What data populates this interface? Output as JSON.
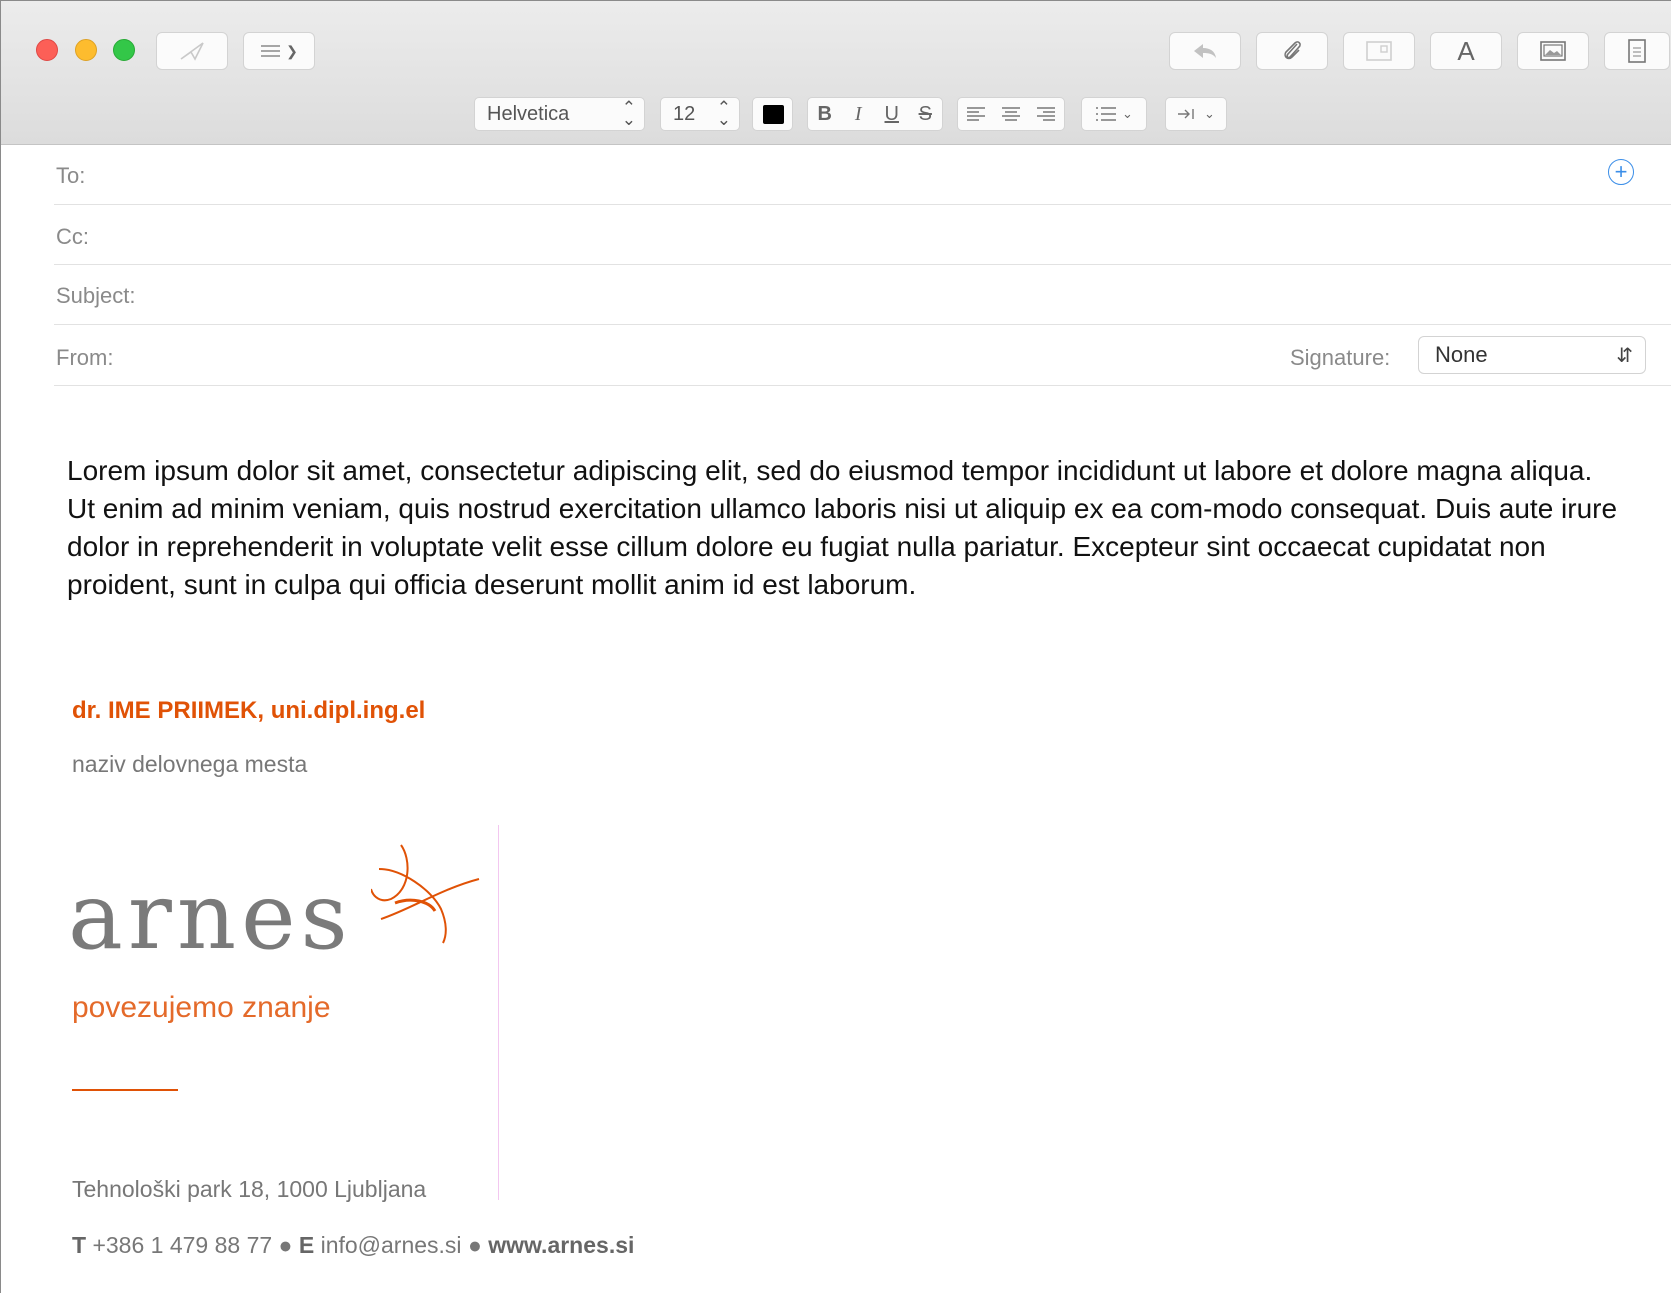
{
  "toolbar": {
    "icons": [
      "send-icon",
      "header-fields-icon",
      "reply-icon",
      "attachment-icon",
      "browser-icon",
      "fonts-icon",
      "photo-browser-icon",
      "stationery-icon"
    ],
    "header_fields_chevron": "⌄"
  },
  "format": {
    "font_family": "Helvetica",
    "font_size": "12",
    "text_color": "#000000",
    "bold": "B",
    "italic": "I",
    "underline": "U",
    "strikethrough": "S"
  },
  "fields": {
    "to_label": "To:",
    "cc_label": "Cc:",
    "subject_label": "Subject:",
    "from_label": "From:",
    "signature_label": "Signature:",
    "signature_value": "None"
  },
  "message": {
    "body": "Lorem ipsum dolor sit amet, consectetur adipiscing elit, sed do eiusmod tempor incididunt ut labore et dolore magna aliqua. Ut enim ad minim veniam, quis nostrud exercitation ullamco laboris nisi ut aliquip ex ea com-modo consequat. Duis aute irure dolor in reprehenderit in voluptate velit esse cillum dolore eu fugiat nulla pariatur. Excepteur sint occaecat cupidatat non proident, sunt in culpa qui officia deserunt mollit anim id est laborum."
  },
  "signature": {
    "name": "dr. IME PRIIMEK, uni.dipl.ing.el",
    "role": "naziv delovnega mesta",
    "logo_word": "arnes",
    "tagline": "povezujemo znanje",
    "address": "Tehnološki park 18, 1000 Ljubljana",
    "phone_label": "T",
    "phone": "+386 1 479 88 77",
    "bullet": "●",
    "email_label": "E",
    "email": "info@arnes.si",
    "website": "www.arnes.si"
  },
  "colors": {
    "accent": "#e05206",
    "link_blue": "#3b8ee8",
    "label_gray": "#8a8a8a"
  }
}
